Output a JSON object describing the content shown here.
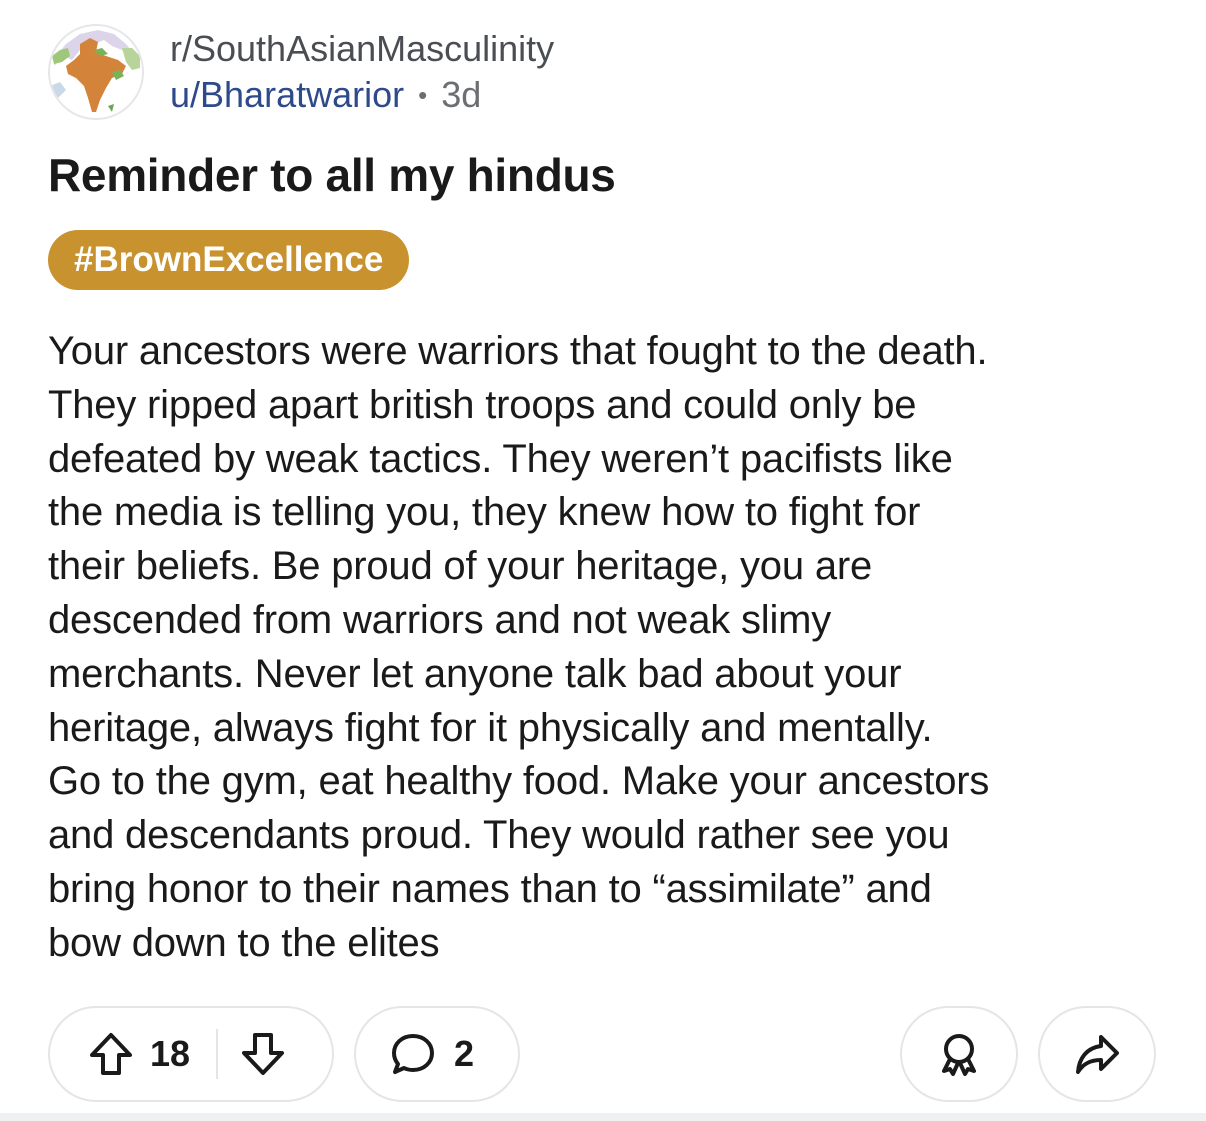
{
  "post": {
    "subreddit": "r/SouthAsianMasculinity",
    "username": "u/Bharatwarior",
    "separator": "•",
    "age": "3d",
    "title": "Reminder to all my hindus",
    "flair": "#BrownExcellence",
    "body": "Your ancestors were warriors that fought to the death.\nThey ripped apart british troops and could only be\ndefeated by weak tactics. They weren’t pacifists like\nthe media is telling you, they knew how to fight for\ntheir beliefs. Be proud of your heritage, you are\ndescended from warriors and not weak slimy\nmerchants. Never let anyone talk bad about your\nheritage, always fight for it physically and mentally.\nGo to the gym, eat healthy food. Make your ancestors\nand descendants proud. They would rather see you\nbring honor to their names than to “assimilate” and\nbow down to the elites"
  },
  "actions": {
    "vote_count": "18",
    "comment_count": "2"
  },
  "icons": {
    "avatar": "india-map-avatar",
    "upvote": "arrow-up-icon",
    "downvote": "arrow-down-icon",
    "comment": "speech-bubble-icon",
    "award": "award-ribbon-icon",
    "share": "share-arrow-icon"
  },
  "colors": {
    "flair_background": "#c8922f",
    "username": "#2e4a8a",
    "text": "#1a1a1b",
    "muted": "#6b6e72",
    "border": "#e3e5e8"
  }
}
